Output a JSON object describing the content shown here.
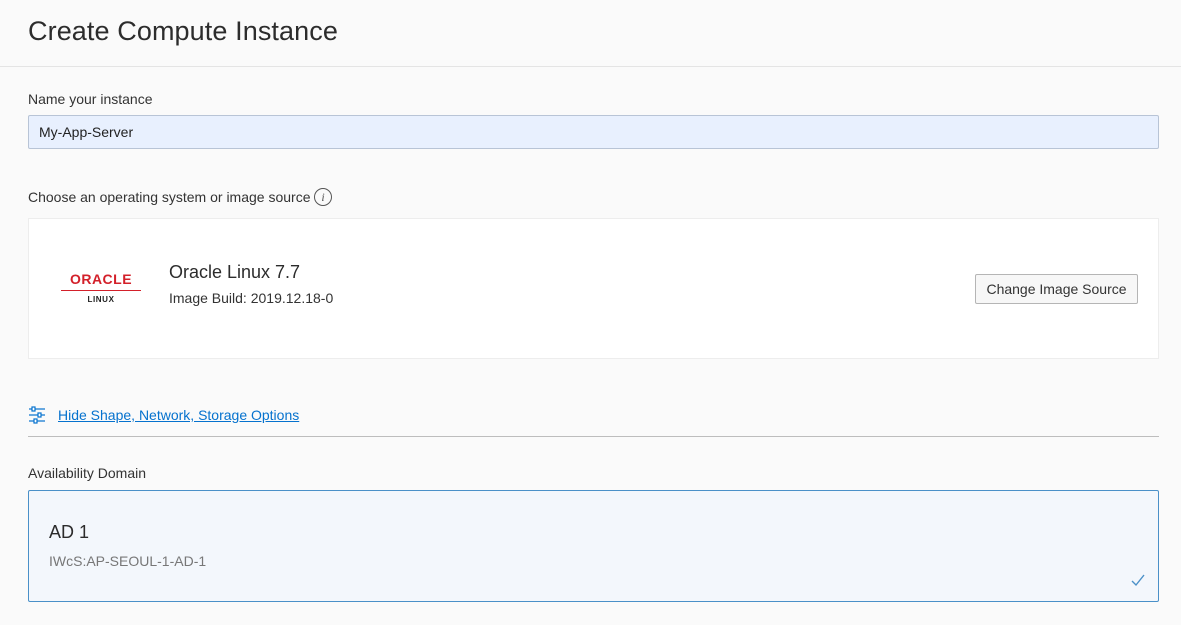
{
  "header": {
    "title": "Create Compute Instance"
  },
  "name_section": {
    "label": "Name your instance",
    "value": "My-App-Server"
  },
  "image_section": {
    "label": "Choose an operating system or image source",
    "info_icon": "info-icon",
    "logo": {
      "brand": "ORACLE",
      "sub": "LINUX"
    },
    "image_name": "Oracle Linux 7.7",
    "image_build": "Image Build: 2019.12.18-0",
    "change_button": "Change Image Source"
  },
  "advanced_toggle": {
    "icon": "sliders-icon",
    "label": "Hide Shape, Network, Storage Options"
  },
  "availability_domain": {
    "label": "Availability Domain",
    "name": "AD 1",
    "id": "IWcS:AP-SEOUL-1-AD-1",
    "selected": true,
    "icon": "check-icon"
  },
  "colors": {
    "link": "#0572ce",
    "oracle_red": "#d3202a",
    "selected_border": "#4a90c8",
    "input_background": "#e8f0fe"
  }
}
